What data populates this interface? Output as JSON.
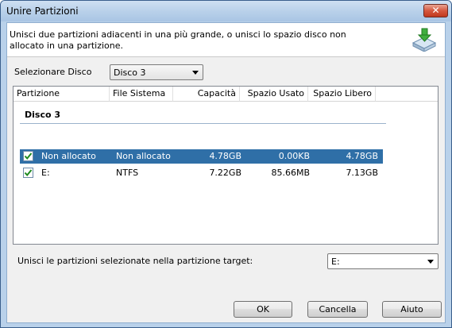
{
  "window": {
    "title": "Unire Partizioni",
    "close_glyph": "✕"
  },
  "header": {
    "description": "Unisci due partizioni adiacenti in una più grande, o unisci lo spazio disco non allocato in una partizione.",
    "icon": "merge-disk-icon"
  },
  "disk_select": {
    "label": "Selezionare Disco",
    "value": "Disco 3"
  },
  "table": {
    "columns": [
      "Partizione",
      "File Sistema",
      "Capacità",
      "Spazio Usato",
      "Spazio Libero"
    ],
    "group": "Disco 3",
    "rows": [
      {
        "checked": true,
        "partition": "Non allocato",
        "fs": "Non allocato",
        "capacity": "4.78GB",
        "used": "0.00KB",
        "free": "4.78GB",
        "selected": true
      },
      {
        "checked": true,
        "partition": "E:",
        "fs": "NTFS",
        "capacity": "7.22GB",
        "used": "85.66MB",
        "free": "7.13GB",
        "selected": false
      }
    ]
  },
  "target": {
    "label": "Unisci le partizioni selezionate nella partizione target:",
    "value": "E:"
  },
  "buttons": {
    "ok": "OK",
    "cancel": "Cancella",
    "help": "Aiuto"
  },
  "colors": {
    "selection": "#2f6fa7",
    "check": "#1f8a1f"
  }
}
